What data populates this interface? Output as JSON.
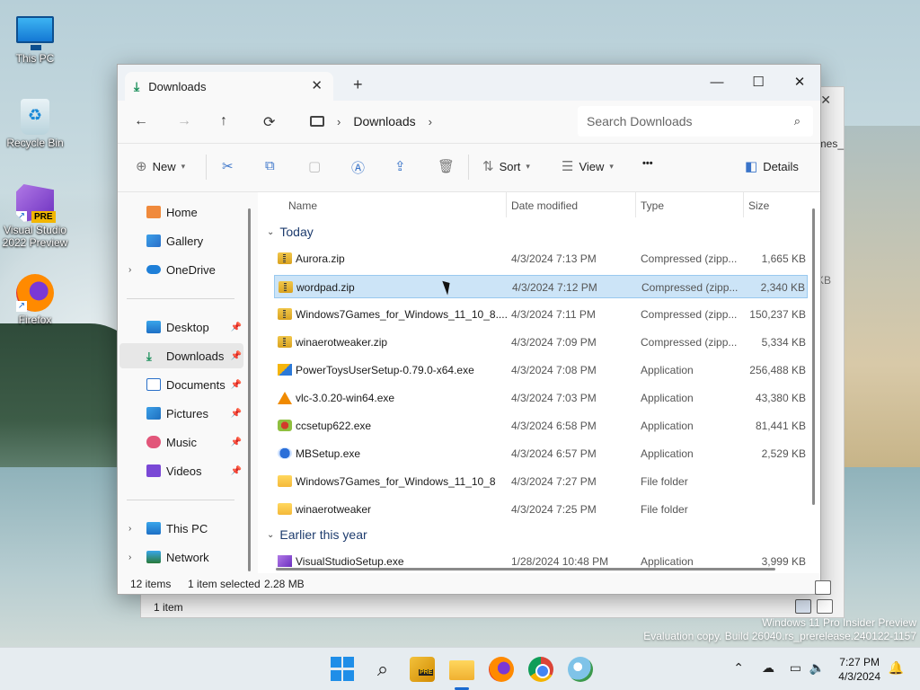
{
  "desktop": {
    "icons": [
      {
        "label": "This PC"
      },
      {
        "label": "Recycle Bin"
      },
      {
        "label": "Visual Studio 2022 Preview",
        "badge": "PRE"
      },
      {
        "label": "Firefox"
      }
    ]
  },
  "bg_window": {
    "frag1": "mes_",
    "frag2": "KB",
    "status": "1 item"
  },
  "window": {
    "tab_title": "Downloads",
    "new_tab": "+",
    "controls": {
      "minimize": "—",
      "maximize": "☐",
      "close": "✕"
    }
  },
  "nav": {
    "back": "←",
    "forward": "→",
    "up": "↑",
    "refresh": "⟳",
    "crumb": "Downloads",
    "sep": "›",
    "search_placeholder": "Search Downloads"
  },
  "toolbar": {
    "new_label": "New",
    "sort_label": "Sort",
    "view_label": "View",
    "more_label": "•••",
    "details_label": "Details"
  },
  "sidebar": {
    "home": "Home",
    "gallery": "Gallery",
    "onedrive": "OneDrive",
    "desktop": "Desktop",
    "downloads": "Downloads",
    "documents": "Documents",
    "pictures": "Pictures",
    "music": "Music",
    "videos": "Videos",
    "thispc": "This PC",
    "network": "Network"
  },
  "columns": {
    "name": "Name",
    "date": "Date modified",
    "type": "Type",
    "size": "Size"
  },
  "groups": {
    "today": "Today",
    "earlier": "Earlier this year"
  },
  "files": [
    {
      "name": "Aurora.zip",
      "date": "4/3/2024 7:13 PM",
      "type": "Compressed (zipp...",
      "size": "1,665 KB",
      "icon": "zip"
    },
    {
      "name": "wordpad.zip",
      "date": "4/3/2024 7:12 PM",
      "type": "Compressed (zipp...",
      "size": "2,340 KB",
      "icon": "zip",
      "selected": true
    },
    {
      "name": "Windows7Games_for_Windows_11_10_8....",
      "date": "4/3/2024 7:11 PM",
      "type": "Compressed (zipp...",
      "size": "150,237 KB",
      "icon": "zip"
    },
    {
      "name": "winaerotweaker.zip",
      "date": "4/3/2024 7:09 PM",
      "type": "Compressed (zipp...",
      "size": "5,334 KB",
      "icon": "zip"
    },
    {
      "name": "PowerToysUserSetup-0.79.0-x64.exe",
      "date": "4/3/2024 7:08 PM",
      "type": "Application",
      "size": "256,488 KB",
      "icon": "powertoys"
    },
    {
      "name": "vlc-3.0.20-win64.exe",
      "date": "4/3/2024 7:03 PM",
      "type": "Application",
      "size": "43,380 KB",
      "icon": "vlc"
    },
    {
      "name": "ccsetup622.exe",
      "date": "4/3/2024 6:58 PM",
      "type": "Application",
      "size": "81,441 KB",
      "icon": "ccleaner"
    },
    {
      "name": "MBSetup.exe",
      "date": "4/3/2024 6:57 PM",
      "type": "Application",
      "size": "2,529 KB",
      "icon": "malwarebytes"
    },
    {
      "name": "Windows7Games_for_Windows_11_10_8",
      "date": "4/3/2024 7:27 PM",
      "type": "File folder",
      "size": "",
      "icon": "folder"
    },
    {
      "name": "winaerotweaker",
      "date": "4/3/2024 7:25 PM",
      "type": "File folder",
      "size": "",
      "icon": "folder"
    }
  ],
  "earlier_files": [
    {
      "name": "VisualStudioSetup.exe",
      "date": "1/28/2024 10:48 PM",
      "type": "Application",
      "size": "3,999 KB",
      "icon": "visualstudio"
    }
  ],
  "status": {
    "count": "12 items",
    "selected": "1 item selected",
    "size": "2.28 MB"
  },
  "watermark": {
    "line1": "Windows 11 Pro Insider Preview",
    "line2": "Evaluation copy. Build 26040.rs_prerelease.240122-1157"
  },
  "taskbar": {
    "vs_badge": "PRE",
    "time": "7:27 PM",
    "date": "4/3/2024"
  }
}
